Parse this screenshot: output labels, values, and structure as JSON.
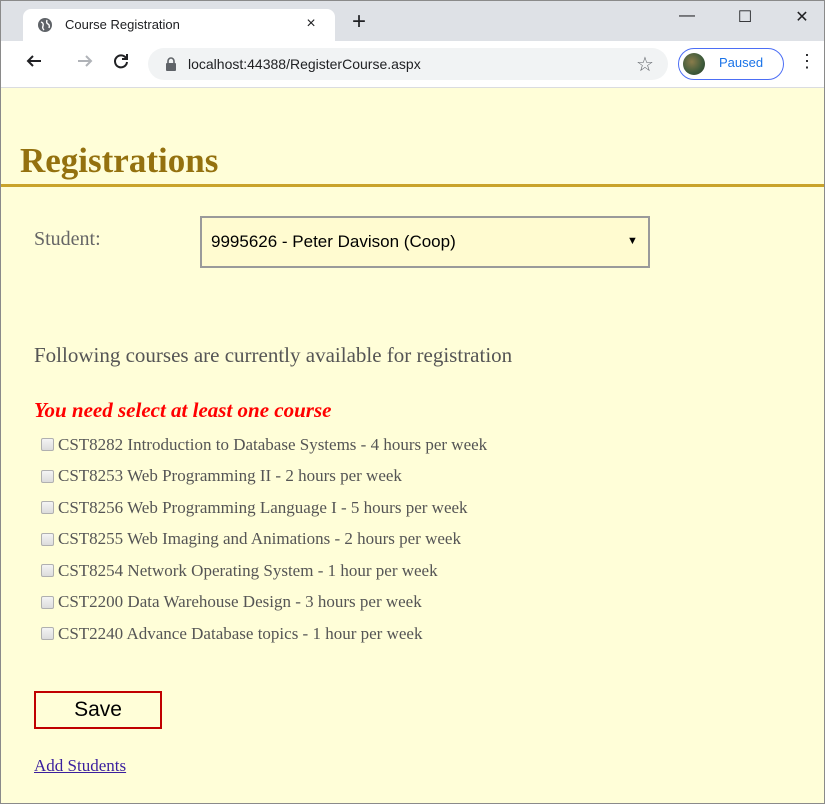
{
  "browser": {
    "tab_title": "Course Registration",
    "tab_close": "×",
    "new_tab": "+",
    "url": "localhost:44388/RegisterCourse.aspx",
    "profile_status": "Paused",
    "window_controls": {
      "minimize": "—",
      "maximize": "☐",
      "close": "✕"
    }
  },
  "page": {
    "heading": "Registrations",
    "student_label": "Student:",
    "student_selected": "9995626 - Peter Davison (Coop)",
    "intro": "Following courses are currently available for registration",
    "error": "You need select at least one course",
    "courses": [
      {
        "label": "CST8282 Introduction to Database Systems - 4 hours per week",
        "checked": false
      },
      {
        "label": "CST8253 Web Programming II - 2 hours per week",
        "checked": false
      },
      {
        "label": "CST8256 Web Programming Language I - 5 hours per week",
        "checked": false
      },
      {
        "label": "CST8255 Web Imaging and Animations - 2 hours per week",
        "checked": false
      },
      {
        "label": "CST8254 Network Operating System - 1 hour per week",
        "checked": false
      },
      {
        "label": "CST2200 Data Warehouse Design - 3 hours per week",
        "checked": false
      },
      {
        "label": "CST2240 Advance Database topics - 1 hour per week",
        "checked": false
      }
    ],
    "save_label": "Save",
    "add_students_link": "Add Students"
  },
  "colors": {
    "page_background": "#fffed8",
    "heading": "#94710f",
    "rule": "#c9a32b",
    "error": "#ff0000",
    "save_border": "#c00000",
    "link": "#3a1f9e"
  }
}
